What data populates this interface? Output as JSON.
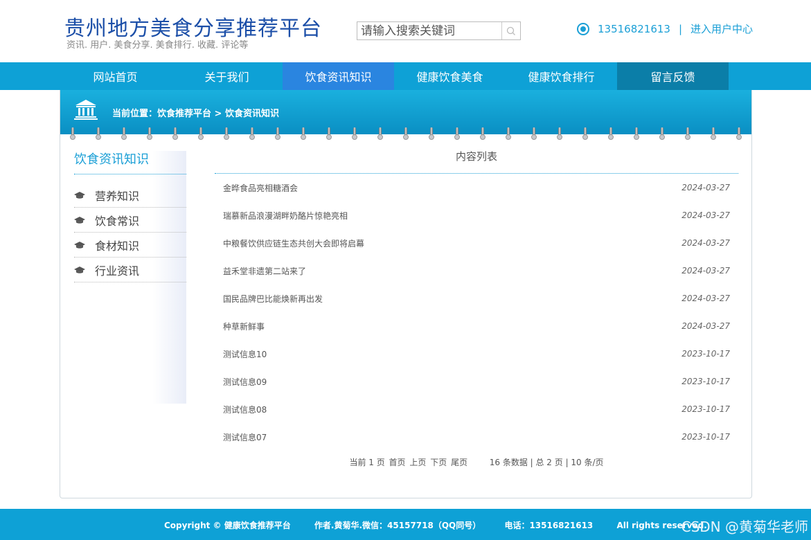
{
  "header": {
    "title": "贵州地方美食分享推荐平台",
    "subtitle": "资讯. 用户. 美食分享. 美食排行. 收藏. 评论等",
    "search_placeholder": "请输入搜索关键词",
    "phone": "13516821613",
    "separator": "|",
    "user_center": "进入用户中心"
  },
  "nav": [
    {
      "label": "网站首页"
    },
    {
      "label": "关于我们"
    },
    {
      "label": "饮食资讯知识"
    },
    {
      "label": "健康饮食美食"
    },
    {
      "label": "健康饮食排行"
    },
    {
      "label": "留言反馈"
    }
  ],
  "breadcrumb": "当前位置：饮食推荐平台 > 饮食资讯知识",
  "sidebar": {
    "title": "饮食资讯知识",
    "items": [
      {
        "label": "营养知识"
      },
      {
        "label": "饮食常识"
      },
      {
        "label": "食材知识"
      },
      {
        "label": "行业资讯"
      }
    ]
  },
  "content": {
    "title": "内容列表",
    "items": [
      {
        "title": "金晔食品亮相糖酒会",
        "date": "2024-03-27"
      },
      {
        "title": "瑞慕新品浪漫湖畔奶酪片惊艳亮相",
        "date": "2024-03-27"
      },
      {
        "title": "中粮餐饮供应链生态共创大会即将启幕",
        "date": "2024-03-27"
      },
      {
        "title": "益禾堂非遗第二站来了",
        "date": "2024-03-27"
      },
      {
        "title": "国民品牌巴比能焕新再出发",
        "date": "2024-03-27"
      },
      {
        "title": "种草新鲜事",
        "date": "2024-03-27"
      },
      {
        "title": "测试信息10",
        "date": "2023-10-17"
      },
      {
        "title": "测试信息09",
        "date": "2023-10-17"
      },
      {
        "title": "测试信息08",
        "date": "2023-10-17"
      },
      {
        "title": "测试信息07",
        "date": "2023-10-17"
      }
    ]
  },
  "pager": {
    "current": "当前 1 页",
    "first": "首页",
    "prev": "上页",
    "next": "下页",
    "last": "尾页",
    "summary": "16 条数据 | 总 2 页 | 10 条/页"
  },
  "footer": {
    "copyright": "Copyright © 健康饮食推荐平台",
    "author": "作者.黄菊华.微信：45157718（QQ同号）",
    "phone": "电话：13516821613",
    "rights": "All rights reserved.",
    "watermark": "CSDN @黄菊华老师"
  },
  "colors": {
    "title_blue": "#1c4fa8",
    "accent": "#0ea1d6",
    "nav_active": "#2a85e0",
    "nav_dark": "#0b7ea8"
  }
}
